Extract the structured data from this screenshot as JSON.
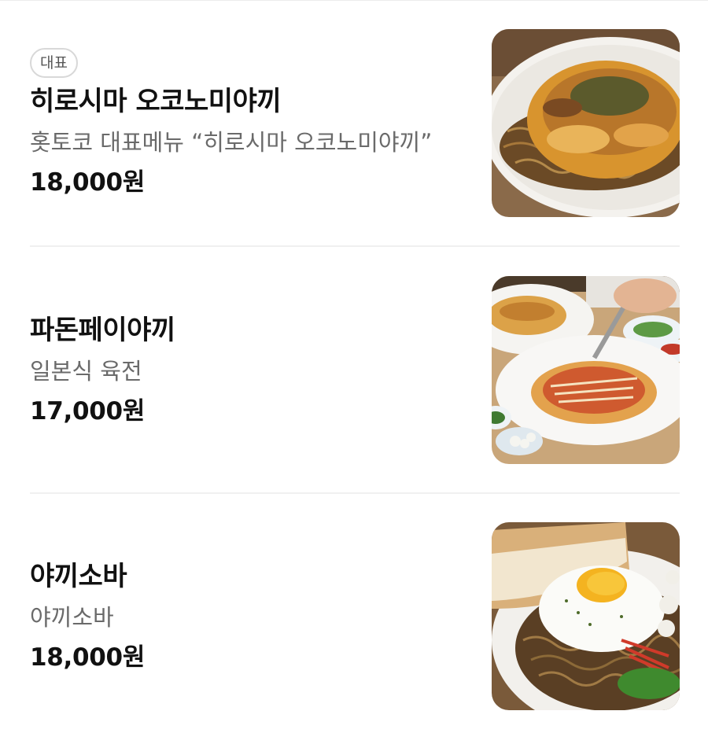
{
  "menu": {
    "items": [
      {
        "badge": "대표",
        "name": "히로시마 오코노미야끼",
        "description": "홋토코 대표메뉴 “히로시마 오코노미야끼”",
        "price": "18,000원",
        "image": "hiroshima-okonomiyaki-photo"
      },
      {
        "name": "파돈페이야끼",
        "description": "일본식 육전",
        "price": "17,000원",
        "image": "tonpeiyaki-photo"
      },
      {
        "name": "야끼소바",
        "description": "야끼소바",
        "price": "18,000원",
        "image": "yakisoba-photo"
      }
    ]
  }
}
